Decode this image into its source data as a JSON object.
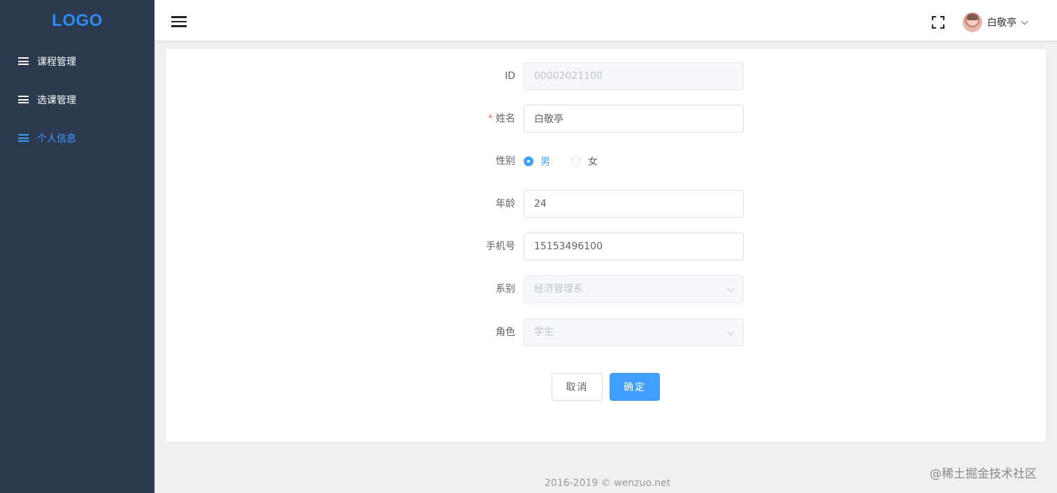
{
  "sidebar": {
    "logo": "LOGO",
    "items": [
      {
        "label": "课程管理",
        "active": false
      },
      {
        "label": "选课管理",
        "active": false
      },
      {
        "label": "个人信息",
        "active": true
      }
    ]
  },
  "header": {
    "user_name": "白敬亭"
  },
  "form": {
    "id": {
      "label": "ID",
      "value": "00002021100"
    },
    "name": {
      "label": "姓名",
      "required_mark": "*",
      "value": "白敬亭"
    },
    "gender": {
      "label": "性别",
      "options": [
        "男",
        "女"
      ],
      "selected": "男"
    },
    "age": {
      "label": "年龄",
      "value": "24"
    },
    "phone": {
      "label": "手机号",
      "value": "15153496100"
    },
    "department": {
      "label": "系别",
      "value": "经济管理系"
    },
    "role": {
      "label": "角色",
      "value": "学生"
    }
  },
  "buttons": {
    "cancel": "取消",
    "confirm": "确定"
  },
  "footer": "2016-2019 © wenzuo.net",
  "watermark": "@稀土掘金技术社区",
  "colors": {
    "sidebar_bg": "#2b3a4f",
    "accent": "#409eff",
    "logo": "#2d8cf0",
    "required": "#f56c6c"
  }
}
